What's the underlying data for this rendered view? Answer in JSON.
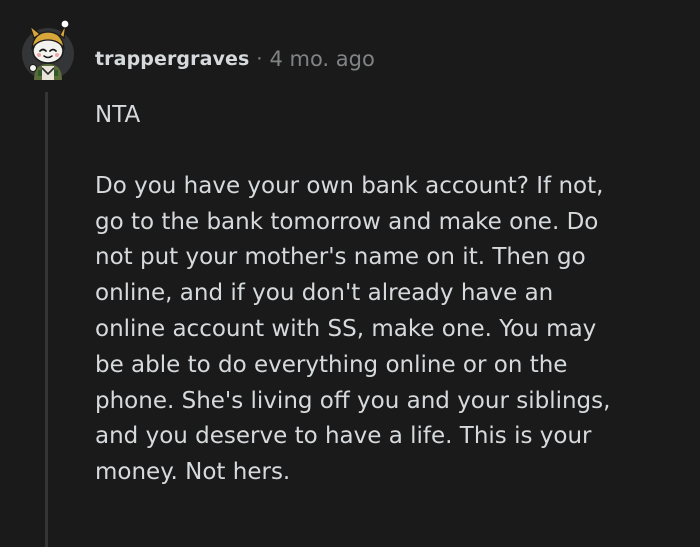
{
  "comment": {
    "author": "trappergraves",
    "separator": "·",
    "timestamp": "4 mo. ago",
    "paragraphs": [
      [
        "NTA"
      ],
      [
        "Do you have your own bank account? If not,",
        "go to the bank tomorrow and make one. Do",
        "not put your mother's name on it. Then go",
        "online, and if you don't already have an",
        "online account with SS, make one. You may",
        "be able to do everything online or on the",
        "phone. She's living off you and your siblings,",
        "and you deserve to have a life. This is your",
        "money. Not hers."
      ]
    ]
  },
  "colors": {
    "background": "#1a1a1b",
    "text": "#d7dadc",
    "meta": "#818384",
    "thread_line": "#343536"
  },
  "icons": {
    "avatar": "snoo-avatar-icon"
  }
}
